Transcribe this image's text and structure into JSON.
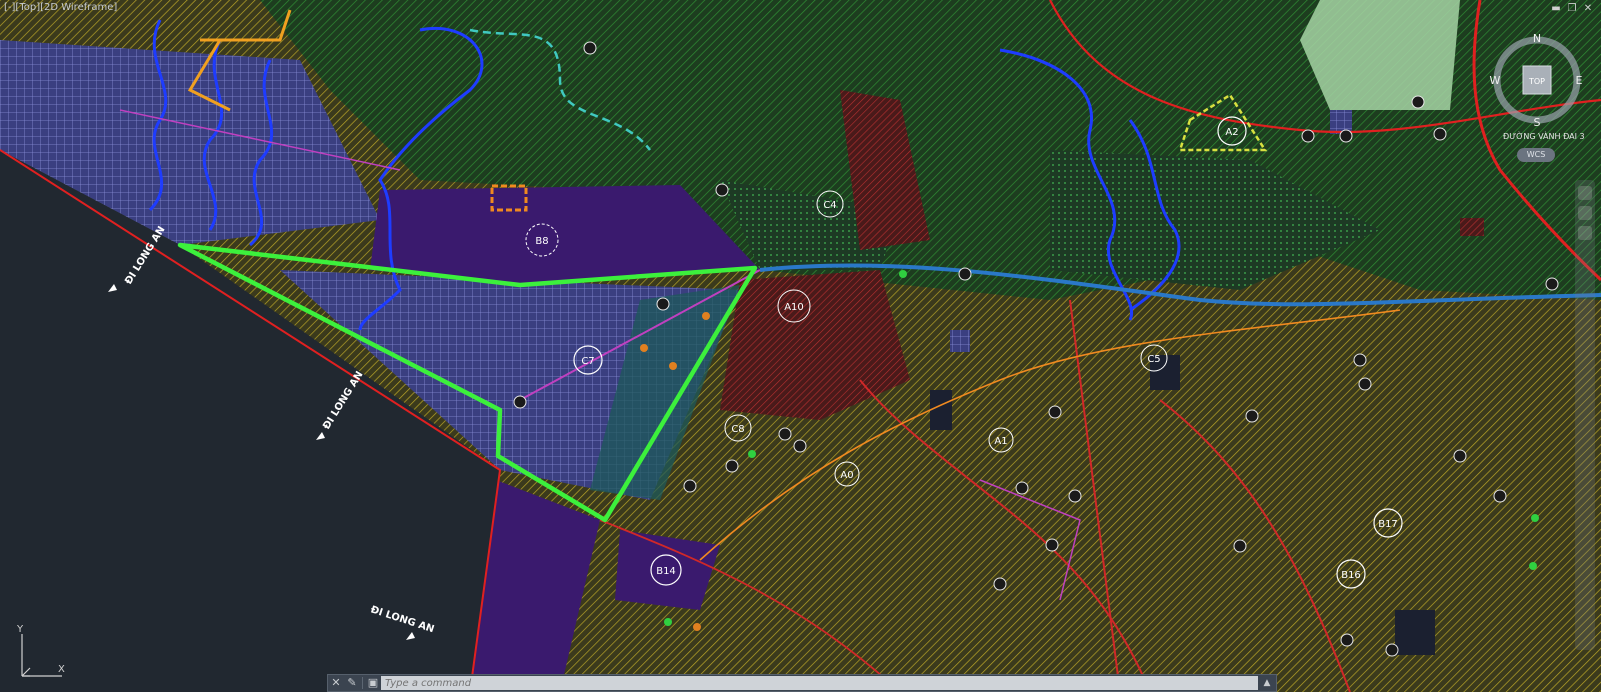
{
  "viewport": {
    "label": "[-][Top][2D Wireframe]",
    "controls": [
      "▬",
      "❐",
      "✕"
    ]
  },
  "viewcube": {
    "north": "N",
    "south": "S",
    "east": "E",
    "west": "W",
    "face": "TOP",
    "wcs": "WCS",
    "road_tag": "ĐƯỜNG VÀNH ĐAI 3"
  },
  "ucs": {
    "y": "Y",
    "x": "X"
  },
  "map_labels": {
    "di_long_an": "ĐI LONG AN",
    "zones": [
      "B8",
      "C4",
      "C7",
      "A10",
      "C8",
      "C5",
      "A1",
      "A0",
      "B14",
      "B17",
      "B16",
      "A2"
    ]
  },
  "command": {
    "placeholder": "Type a command",
    "close_icon": "✕",
    "wrench_icon": "✎",
    "prompt_icon": "▣"
  },
  "colors": {
    "background": "#212830",
    "boundary": "#3cf03c",
    "river": "#1e3cff",
    "road_red": "#e02020",
    "hatch_yellow": "#c8b428",
    "hatch_green": "#2e8a2e",
    "purple": "#3c1e78",
    "lavender": "#4a4a9a"
  }
}
